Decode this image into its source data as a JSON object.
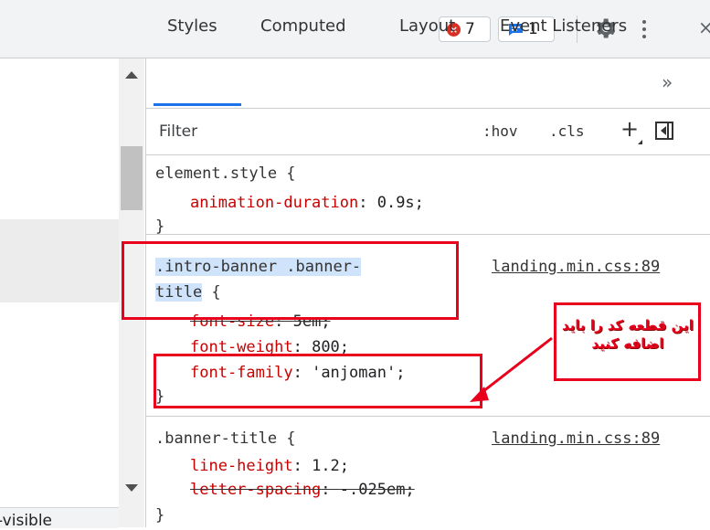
{
  "toolbar": {
    "errors_count": "7",
    "issues_count": "1",
    "error_icon_glyph": "×"
  },
  "left_panel": {
    "bottom_text": "-visible"
  },
  "tabs": [
    {
      "label": "Styles",
      "active": true
    },
    {
      "label": "Computed",
      "active": false
    },
    {
      "label": "Layout",
      "active": false
    },
    {
      "label": "Event Listeners",
      "active": false
    }
  ],
  "tabs_overflow": "»",
  "filter": {
    "placeholder": "Filter",
    "hov": ":hov",
    "cls": ".cls",
    "plus": "+"
  },
  "rules": [
    {
      "selector": "element.style {",
      "declarations": [
        {
          "prop": "animation-duration",
          "value": "0.9s;",
          "struck": false
        }
      ],
      "close": "}"
    },
    {
      "selector_line1": ".intro-banner .banner-",
      "selector_line2": "title",
      "selector_open": " {",
      "source": "landing.min.css:89",
      "declarations": [
        {
          "prop": "font-size",
          "value": "5em;",
          "struck": true
        },
        {
          "prop": "font-weight",
          "value": "800;",
          "struck": false
        },
        {
          "prop": "font-family",
          "value": "'anjoman';",
          "struck": false
        }
      ],
      "close": "}"
    },
    {
      "selector": ".banner-title {",
      "source": "landing.min.css:89",
      "declarations": [
        {
          "prop": "line-height",
          "value": "1.2;",
          "struck": false
        },
        {
          "prop": "letter-spacing",
          "value": "-.025em;",
          "struck": true
        }
      ],
      "close": "}"
    }
  ],
  "annotation": {
    "note": "این قطعه کد را باید اضافه کنید",
    "color": "#e8001c"
  },
  "colors": {
    "accent": "#1a73e8",
    "property": "#c80000",
    "annotation_red": "#e8001c",
    "error": "#d93025",
    "selector_highlight": "#cfe3fb"
  }
}
